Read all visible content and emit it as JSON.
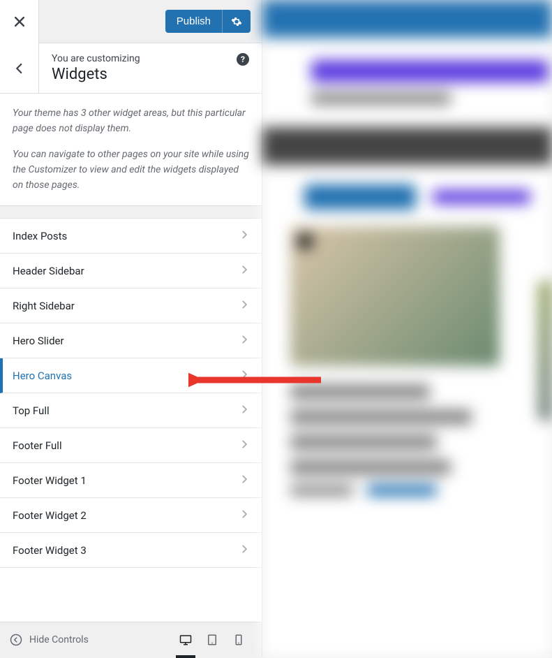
{
  "toolbar": {
    "publish_label": "Publish"
  },
  "header": {
    "customizing_label": "You are customizing",
    "section_title": "Widgets",
    "help_symbol": "?"
  },
  "description": {
    "para1": "Your theme has 3 other widget areas, but this particular page does not display them.",
    "para2": "You can navigate to other pages on your site while using the Customizer to view and edit the widgets displayed on those pages."
  },
  "widget_areas": [
    {
      "label": "Index Posts",
      "active": false
    },
    {
      "label": "Header Sidebar",
      "active": false
    },
    {
      "label": "Right Sidebar",
      "active": false
    },
    {
      "label": "Hero Slider",
      "active": false
    },
    {
      "label": "Hero Canvas",
      "active": true
    },
    {
      "label": "Top Full",
      "active": false
    },
    {
      "label": "Footer Full",
      "active": false
    },
    {
      "label": "Footer Widget 1",
      "active": false
    },
    {
      "label": "Footer Widget 2",
      "active": false
    },
    {
      "label": "Footer Widget 3",
      "active": false
    }
  ],
  "footer": {
    "hide_controls_label": "Hide Controls"
  }
}
